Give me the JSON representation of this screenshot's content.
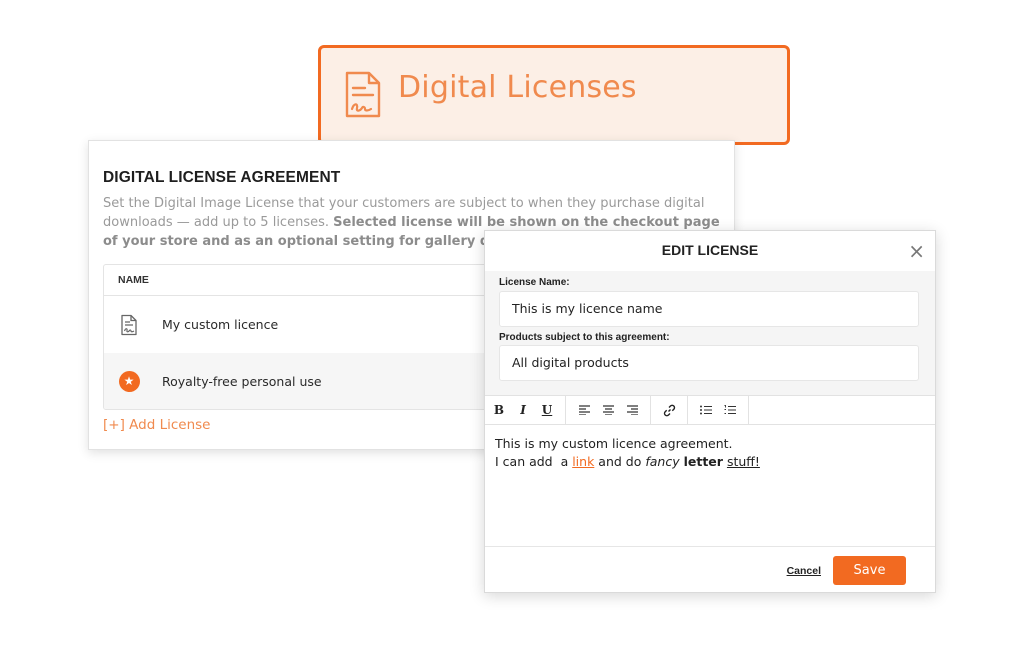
{
  "header": {
    "title": "Digital Licenses",
    "icon": "license-document-icon"
  },
  "agreement": {
    "title": "DIGITAL LICENSE AGREEMENT",
    "desc_plain": "Set the Digital Image License that your customers are subject to when they purchase digital downloads — add up to 5 licenses. ",
    "desc_bold": "Selected license will be shown on the checkout page of your store and as an optional setting for gallery downl",
    "table_header": "NAME",
    "rows": [
      {
        "label": "My custom licence",
        "icon": "license-document-icon"
      },
      {
        "label": "Royalty-free personal use",
        "icon": "star-icon"
      }
    ],
    "add_license": "[+] Add License"
  },
  "dialog": {
    "title": "EDIT LICENSE",
    "close": "×",
    "name_label": "License Name:",
    "name_value": "This is my licence name",
    "products_label": "Products subject to this agreement:",
    "products_value": "All digital products",
    "toolbar": {
      "bold": "B",
      "italic": "I",
      "underline": "U"
    },
    "editor": {
      "line1": "This is my custom licence agreement.",
      "line2_a": "I can add  a ",
      "line2_link": "link",
      "line2_b": " and do ",
      "line2_italic": "fancy",
      "line2_space": " ",
      "line2_bold": "letter",
      "line2_underline": "stuff!"
    },
    "cancel": "Cancel",
    "save": "Save"
  },
  "colors": {
    "accent": "#f26a21",
    "accent_light": "#fcefe6"
  }
}
